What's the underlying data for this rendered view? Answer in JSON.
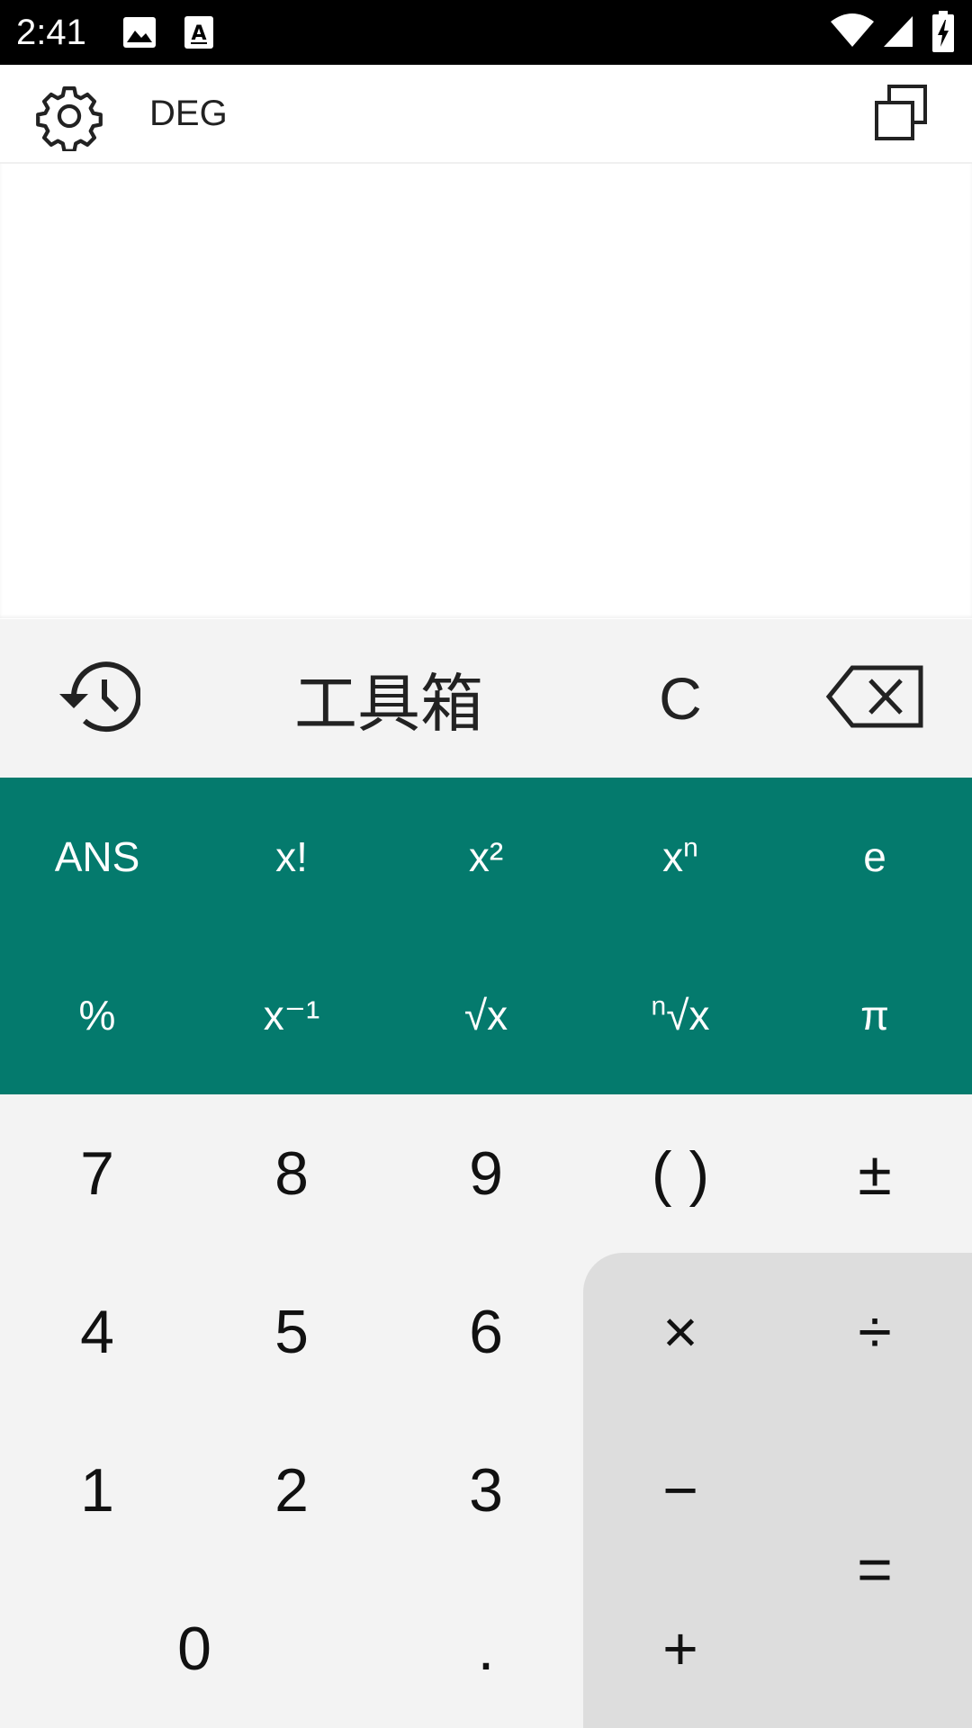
{
  "status_bar": {
    "time": "2:41",
    "icons": [
      "image-icon",
      "text-a-icon",
      "wifi-icon",
      "cell-signal-icon",
      "battery-charging-icon"
    ]
  },
  "app_bar": {
    "mode": "DEG",
    "settings_icon": "gear-icon",
    "copy_icon": "copy-icon"
  },
  "function_row": {
    "history_icon": "history-icon",
    "toolbox": "工具箱",
    "clear": "C",
    "backspace_icon": "backspace-icon"
  },
  "scientific": {
    "row1": [
      "ANS",
      "x!",
      "x²",
      "xⁿ",
      "e"
    ],
    "ans": "ANS",
    "factorial": "x!",
    "square": "x²",
    "power_base": "x",
    "power_exp": "n",
    "euler": "e",
    "percent": "%",
    "inverse": "x⁻¹",
    "sqrt": "√x",
    "nroot_exp": "n",
    "nroot_base": "√x",
    "pi": "π"
  },
  "numpad": {
    "k7": "7",
    "k8": "8",
    "k9": "9",
    "paren": "( )",
    "plus_minus": "±",
    "k4": "4",
    "k5": "5",
    "k6": "6",
    "multiply": "×",
    "divide": "÷",
    "k1": "1",
    "k2": "2",
    "k3": "3",
    "minus": "−",
    "k0": "0",
    "dot": ".",
    "plus": "+",
    "equals": "="
  },
  "colors": {
    "scientific_panel": "#047a6d",
    "key_background": "#f3f3f3",
    "operator_panel": "#dddddd",
    "status_bar": "#000000"
  }
}
